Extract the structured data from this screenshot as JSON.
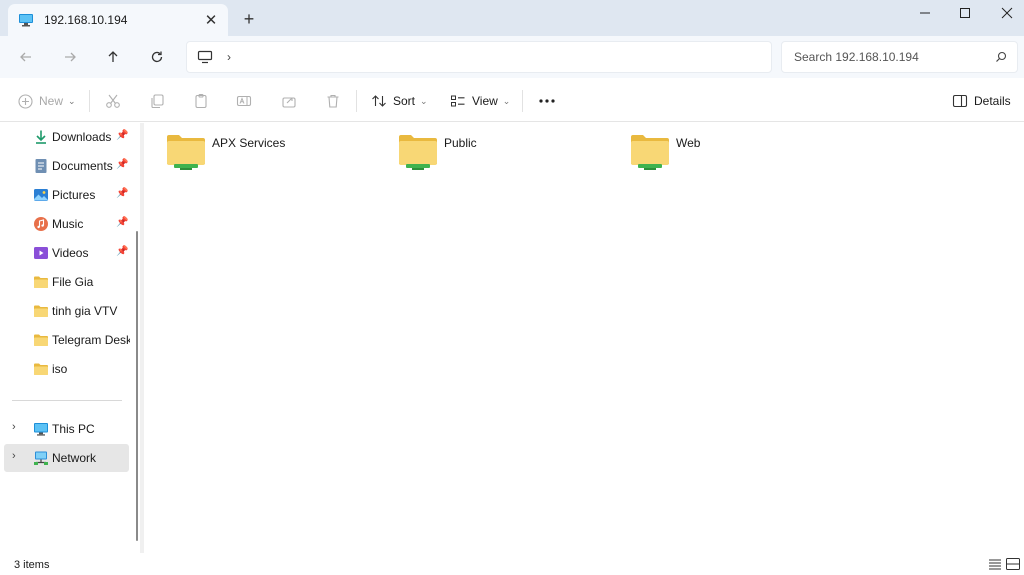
{
  "window": {
    "tab_title": "192.168.10.194",
    "new_tab_icon": "plus-icon"
  },
  "nav": {
    "address_icon": "monitor-icon",
    "search_placeholder": "Search 192.168.10.194"
  },
  "commands": {
    "new": "New",
    "sort": "Sort",
    "view": "View",
    "details": "Details"
  },
  "sidebar": {
    "quick_access": [
      {
        "label": "Downloads",
        "icon": "download-arrow-icon",
        "pinned": true
      },
      {
        "label": "Documents",
        "icon": "documents-icon",
        "pinned": true
      },
      {
        "label": "Pictures",
        "icon": "pictures-icon",
        "pinned": true
      },
      {
        "label": "Music",
        "icon": "music-icon",
        "pinned": true
      },
      {
        "label": "Videos",
        "icon": "videos-icon",
        "pinned": true
      },
      {
        "label": "File Gia",
        "icon": "folder-icon",
        "pinned": false
      },
      {
        "label": "tinh gia VTV",
        "icon": "folder-icon",
        "pinned": false
      },
      {
        "label": "Telegram Desktop",
        "icon": "folder-icon",
        "pinned": false
      },
      {
        "label": "iso",
        "icon": "folder-icon",
        "pinned": false
      }
    ],
    "this_pc": "This PC",
    "network": "Network"
  },
  "folders": [
    {
      "name": "APX Services",
      "icon": "network-folder-icon"
    },
    {
      "name": "Public",
      "icon": "network-folder-icon"
    },
    {
      "name": "Web",
      "icon": "network-folder-icon"
    }
  ],
  "status": {
    "item_count": "3 items"
  },
  "colors": {
    "titlebar_bg": "#dfe7f1",
    "folder_yellow": "#f8d775",
    "folder_back": "#e9b93f",
    "share_green": "#3fb34f",
    "selected_bg": "#e6e6e6"
  }
}
